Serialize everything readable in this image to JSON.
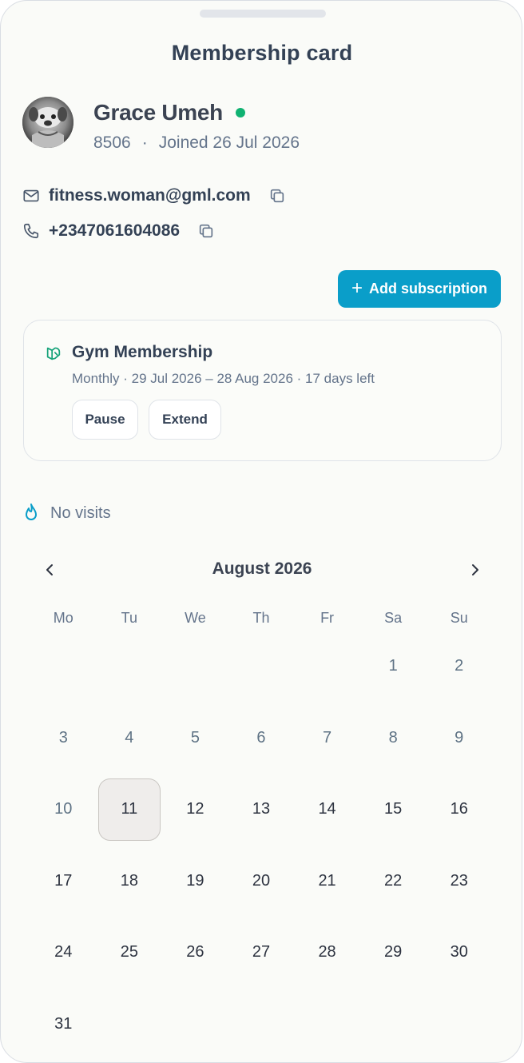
{
  "header": {
    "title": "Membership card"
  },
  "member": {
    "name": "Grace Umeh",
    "id": "8506",
    "separator": "·",
    "joined": "Joined 26 Jul 2026",
    "status_color": "#10b272",
    "email": "fitness.woman@gml.com",
    "phone": "+2347061604086"
  },
  "actions": {
    "add_subscription": "Add subscription"
  },
  "subscription": {
    "title": "Gym Membership",
    "detail": "Monthly · 29 Jul 2026 – 28 Aug 2026 · 17 days left",
    "pause_label": "Pause",
    "extend_label": "Extend",
    "icon": "membership-icon"
  },
  "visits": {
    "label": "No visits",
    "icon": "flame-icon"
  },
  "calendar": {
    "month_label": "August 2026",
    "weekdays": [
      "Mo",
      "Tu",
      "We",
      "Th",
      "Fr",
      "Sa",
      "Su"
    ],
    "leading_blanks": 5,
    "days_in_month": 31,
    "today": 11
  },
  "colors": {
    "accent": "#0a9ec9",
    "online": "#10b272",
    "membership_icon": "#16a37a"
  }
}
